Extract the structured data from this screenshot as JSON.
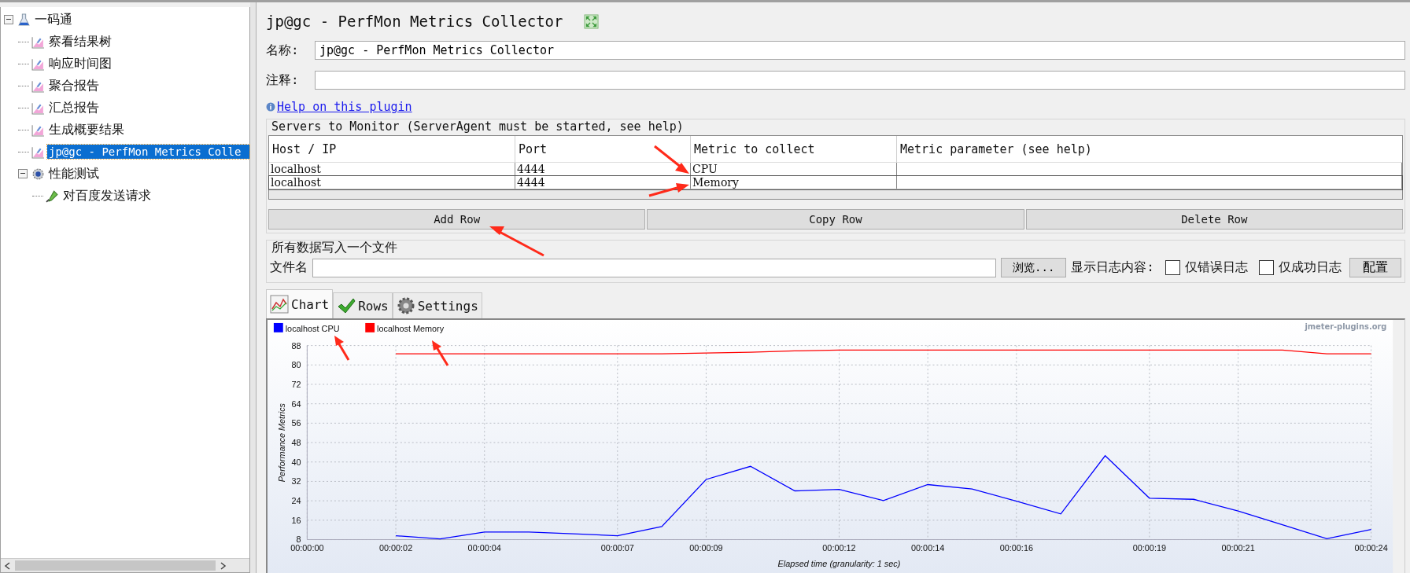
{
  "tree": [
    {
      "label": "一码通",
      "kind": "plan",
      "expanded": true,
      "selected": false,
      "children": [
        {
          "label": "察看结果树",
          "kind": "listener",
          "selected": false
        },
        {
          "label": "响应时间图",
          "kind": "listener",
          "selected": false
        },
        {
          "label": "聚合报告",
          "kind": "listener",
          "selected": false
        },
        {
          "label": "汇总报告",
          "kind": "listener",
          "selected": false
        },
        {
          "label": "生成概要结果",
          "kind": "listener",
          "selected": false
        },
        {
          "label": "jp@gc - PerfMon Metrics Colle",
          "kind": "listener",
          "selected": true
        },
        {
          "label": "性能测试",
          "kind": "threadgroup",
          "expanded": true,
          "selected": false,
          "children": [
            {
              "label": "对百度发送请求",
              "kind": "sampler",
              "selected": false
            }
          ]
        }
      ]
    }
  ],
  "panel": {
    "title": "jp@gc - PerfMon Metrics Collector",
    "name_label": "名称:",
    "name_value": "jp@gc - PerfMon Metrics Collector",
    "comment_label": "注释:",
    "help_link": "Help on this plugin"
  },
  "servers": {
    "title": "Servers to Monitor (ServerAgent must be started, see help)",
    "columns": [
      "Host / IP",
      "Port",
      "Metric to collect",
      "Metric parameter (see help)"
    ],
    "rows": [
      {
        "host": "localhost",
        "port": "4444",
        "metric": "CPU",
        "selected": false
      },
      {
        "host": "localhost",
        "port": "4444",
        "metric": "Memory",
        "selected": true
      }
    ],
    "buttons": [
      "Add Row",
      "Copy Row",
      "Delete Row"
    ]
  },
  "file": {
    "title": "所有数据写入一个文件",
    "label": "文件名",
    "browse": "浏览...",
    "log_label": "显示日志内容:",
    "checks": [
      {
        "label": "仅错误日志",
        "checked": false
      },
      {
        "label": "仅成功日志",
        "checked": false
      }
    ],
    "config": "配置"
  },
  "tabs": [
    {
      "label": "Chart",
      "kind": "chart",
      "selected": true
    },
    {
      "label": "Rows",
      "kind": "rows",
      "selected": false
    },
    {
      "label": "Settings",
      "kind": "settings",
      "selected": false
    }
  ],
  "chart": {
    "credit": "jmeter-plugins.org",
    "chart_data": {
      "type": "line",
      "xlabel": "Elapsed time (granularity: 1 sec)",
      "ylabel": "Performance Metrics",
      "x": [
        2,
        3,
        4,
        5,
        6,
        7,
        8,
        9,
        10,
        11,
        12,
        13,
        14,
        15,
        16,
        17,
        18,
        19,
        20,
        21,
        22,
        23,
        24
      ],
      "series": [
        {
          "name": "localhost CPU",
          "color": "#0000ff",
          "values": [
            9.6,
            8.3,
            11.1,
            11.1,
            10.4,
            9.6,
            13.4,
            32.8,
            38.2,
            28.1,
            28.7,
            24.1,
            30.7,
            28.9,
            23.8,
            18.6,
            42.6,
            25.1,
            24.6,
            19.8,
            14.1,
            8.4,
            12.2
          ]
        },
        {
          "name": "localhost Memory",
          "color": "#ff0000",
          "values": [
            84.6,
            84.6,
            84.6,
            84.6,
            84.6,
            84.6,
            84.6,
            84.9,
            85.2,
            85.8,
            86.1,
            86.1,
            86.1,
            86.1,
            86.1,
            86.1,
            86.1,
            86.1,
            86.1,
            86.1,
            86.1,
            84.6,
            84.6
          ]
        }
      ],
      "xlim": [
        0,
        24
      ],
      "ylim": [
        8,
        88
      ],
      "xticks": [
        {
          "value": 0,
          "label": "00:00:00"
        },
        {
          "value": 2,
          "label": "00:00:02"
        },
        {
          "value": 4,
          "label": "00:00:04"
        },
        {
          "value": 7,
          "label": "00:00:07"
        },
        {
          "value": 9,
          "label": "00:00:09"
        },
        {
          "value": 12,
          "label": "00:00:12"
        },
        {
          "value": 14,
          "label": "00:00:14"
        },
        {
          "value": 16,
          "label": "00:00:16"
        },
        {
          "value": 19,
          "label": "00:00:19"
        },
        {
          "value": 21,
          "label": "00:00:21"
        },
        {
          "value": 24,
          "label": "00:00:24"
        }
      ],
      "yticks": [
        8,
        16,
        24,
        32,
        40,
        48,
        56,
        64,
        72,
        80,
        88
      ],
      "grid": true,
      "legend": "top-left"
    }
  }
}
